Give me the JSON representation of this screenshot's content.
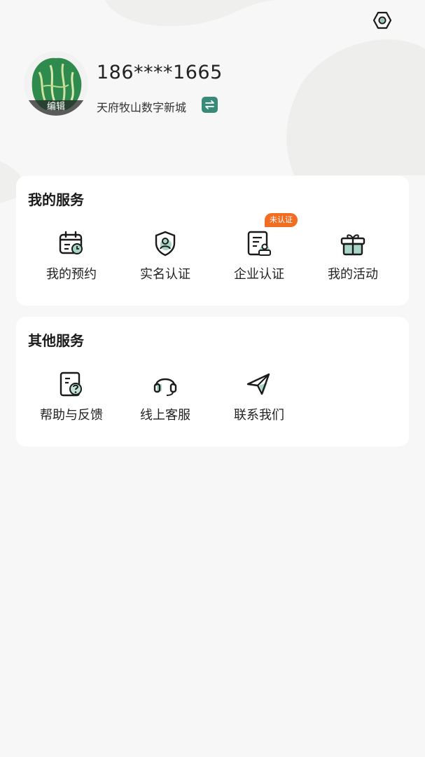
{
  "profile": {
    "phone": "186****1665",
    "location": "天府牧山数字新城",
    "avatar_edit": "编辑"
  },
  "my_services": {
    "title": "我的服务",
    "items": [
      {
        "label": "我的预约",
        "icon": "calendar-clock-icon"
      },
      {
        "label": "实名认证",
        "icon": "shield-user-icon"
      },
      {
        "label": "企业认证",
        "icon": "document-user-icon",
        "badge": "未认证"
      },
      {
        "label": "我的活动",
        "icon": "gift-icon"
      }
    ]
  },
  "other_services": {
    "title": "其他服务",
    "items": [
      {
        "label": "帮助与反馈",
        "icon": "document-question-icon"
      },
      {
        "label": "线上客服",
        "icon": "headset-icon"
      },
      {
        "label": "联系我们",
        "icon": "paper-plane-icon"
      }
    ]
  },
  "colors": {
    "accent": "#3a8a7a",
    "badge": "#f26d21",
    "background": "#f7f7f7"
  }
}
